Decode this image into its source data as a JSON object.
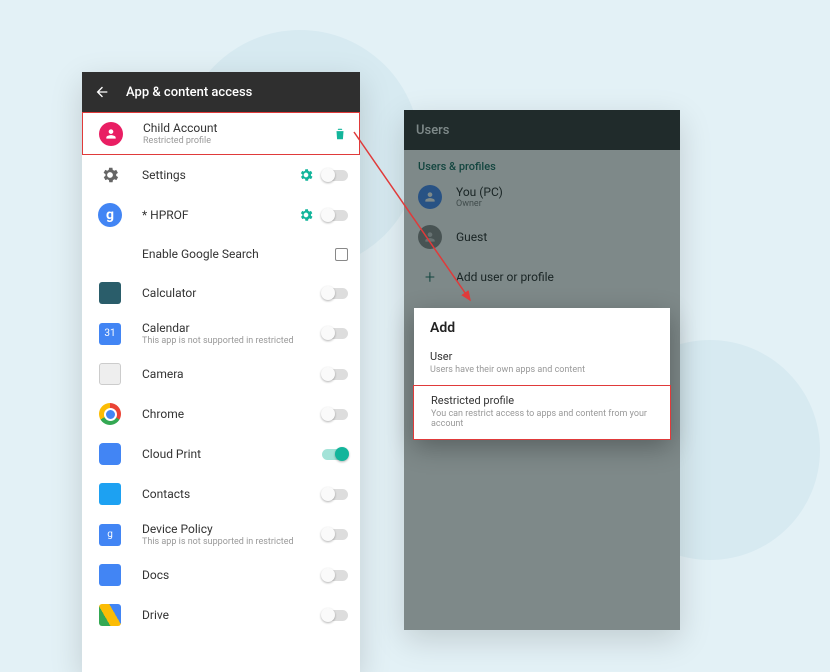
{
  "left": {
    "appbar_title": "App & content access",
    "profile": {
      "name": "Child Account",
      "sub": "Restricted profile"
    },
    "settings_label": "Settings",
    "hprof_label": "* HPROF",
    "google_search_label": "Enable Google Search",
    "apps": [
      {
        "name": "Calculator"
      },
      {
        "name": "Calendar",
        "sub": "This app is not supported in restricted"
      },
      {
        "name": "Camera"
      },
      {
        "name": "Chrome"
      },
      {
        "name": "Cloud Print",
        "on": true
      },
      {
        "name": "Contacts"
      },
      {
        "name": "Device Policy",
        "sub": "This app is not supported in restricted"
      },
      {
        "name": "Docs"
      },
      {
        "name": "Drive"
      }
    ]
  },
  "right": {
    "appbar_title": "Users",
    "section": "Users & profiles",
    "you": {
      "title": "You (PC)",
      "sub": "Owner"
    },
    "guest": "Guest",
    "add_link": "Add user or profile",
    "dialog": {
      "title": "Add",
      "user": {
        "title": "User",
        "sub": "Users have their own apps and content"
      },
      "restricted": {
        "title": "Restricted profile",
        "sub": "You can restrict access to apps and content from your account"
      }
    }
  }
}
